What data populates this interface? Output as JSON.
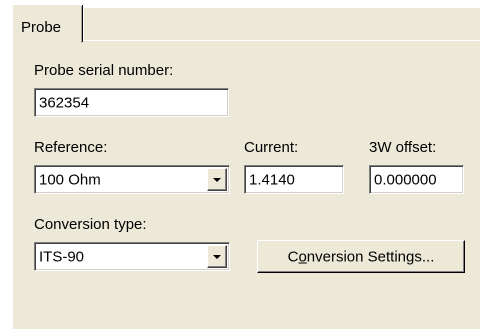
{
  "tabs": [
    {
      "label": "Probe",
      "selected": true
    }
  ],
  "probe_serial": {
    "label": "Probe serial number:",
    "value": "362354"
  },
  "reference": {
    "label": "Reference:",
    "value": "100 Ohm"
  },
  "current": {
    "label": "Current:",
    "value": "1.4140"
  },
  "offset_3w": {
    "label": "3W offset:",
    "value": "0.000000"
  },
  "conversion_type": {
    "label": "Conversion type:",
    "value": "ITS-90"
  },
  "conversion_settings_button": {
    "mnemonic_prefix": "C",
    "mnemonic_char": "o",
    "label_rest": "nversion Settings..."
  },
  "colors": {
    "panel_bg": "#ece9d8",
    "field_bg": "#ffffff"
  },
  "icons": {
    "dropdown": "chevron-down-icon"
  }
}
